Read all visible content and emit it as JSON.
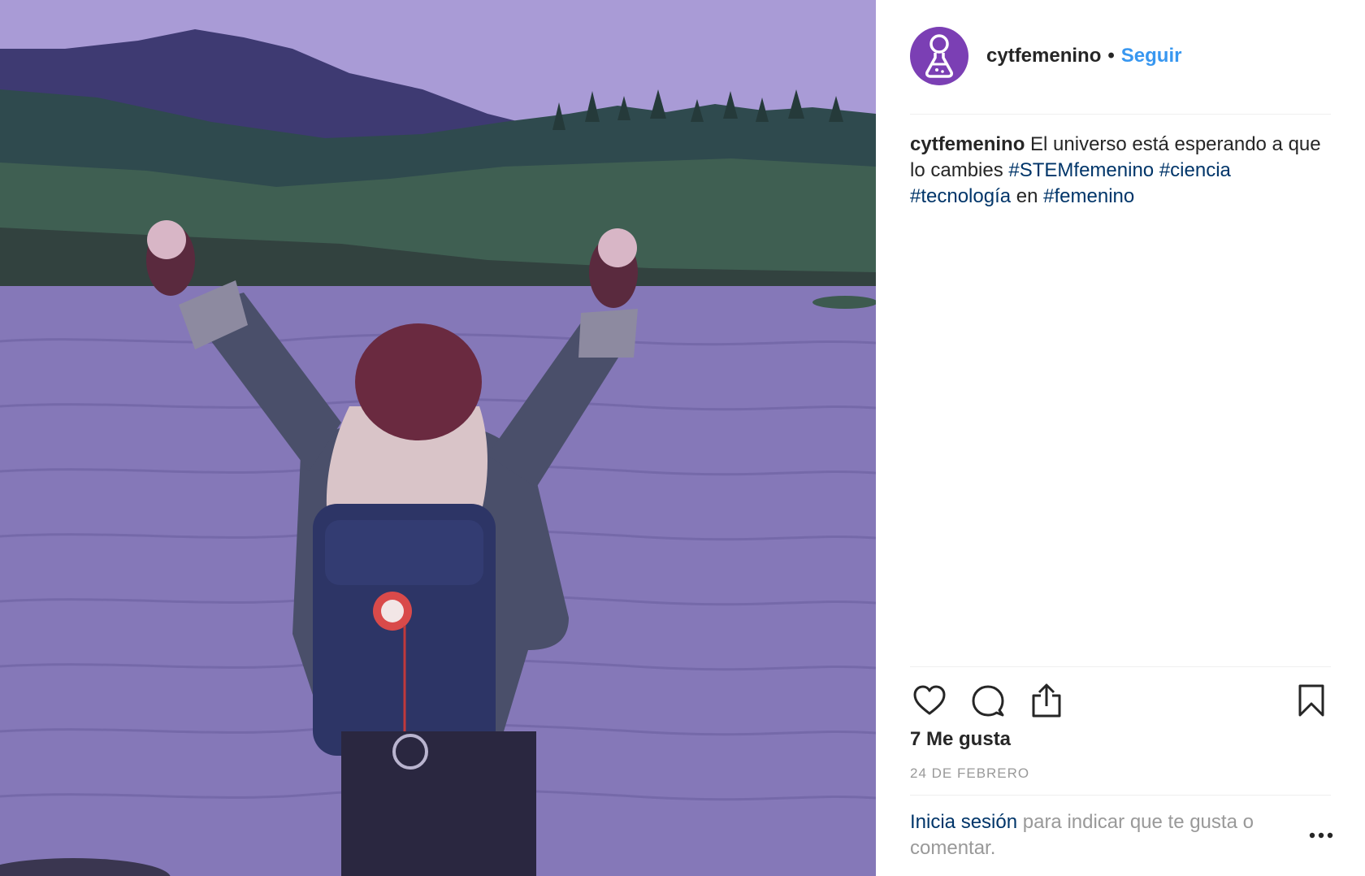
{
  "account": {
    "username": "cytfemenino",
    "separator": "•",
    "follow_label": "Seguir"
  },
  "caption": {
    "username": "cytfemenino",
    "text": " El universo está esperando a que lo cambies ",
    "tag1": "#STEMfemenino",
    "space1": " ",
    "tag2": "#ciencia",
    "space2": " ",
    "tag3": "#tecnología",
    "joiner": " en ",
    "tag4": "#femenino"
  },
  "stats": {
    "likes_label": "7 Me gusta",
    "date_label": "24 DE FEBRERO"
  },
  "login_prompt": {
    "link": "Inicia sesión",
    "text": " para indicar que te gusta o comentar."
  },
  "icons": {
    "avatar": "flask-person-icon",
    "like": "heart-icon",
    "comment": "comment-bubble-icon",
    "share": "share-upload-icon",
    "save": "bookmark-icon",
    "more": "more-options-icon"
  },
  "colors": {
    "follow": "#3897f0",
    "hashtag": "#003569",
    "muted": "#999999",
    "avatar_bg": "#7b3fb4",
    "photo_tint": "#8a7cbd"
  }
}
